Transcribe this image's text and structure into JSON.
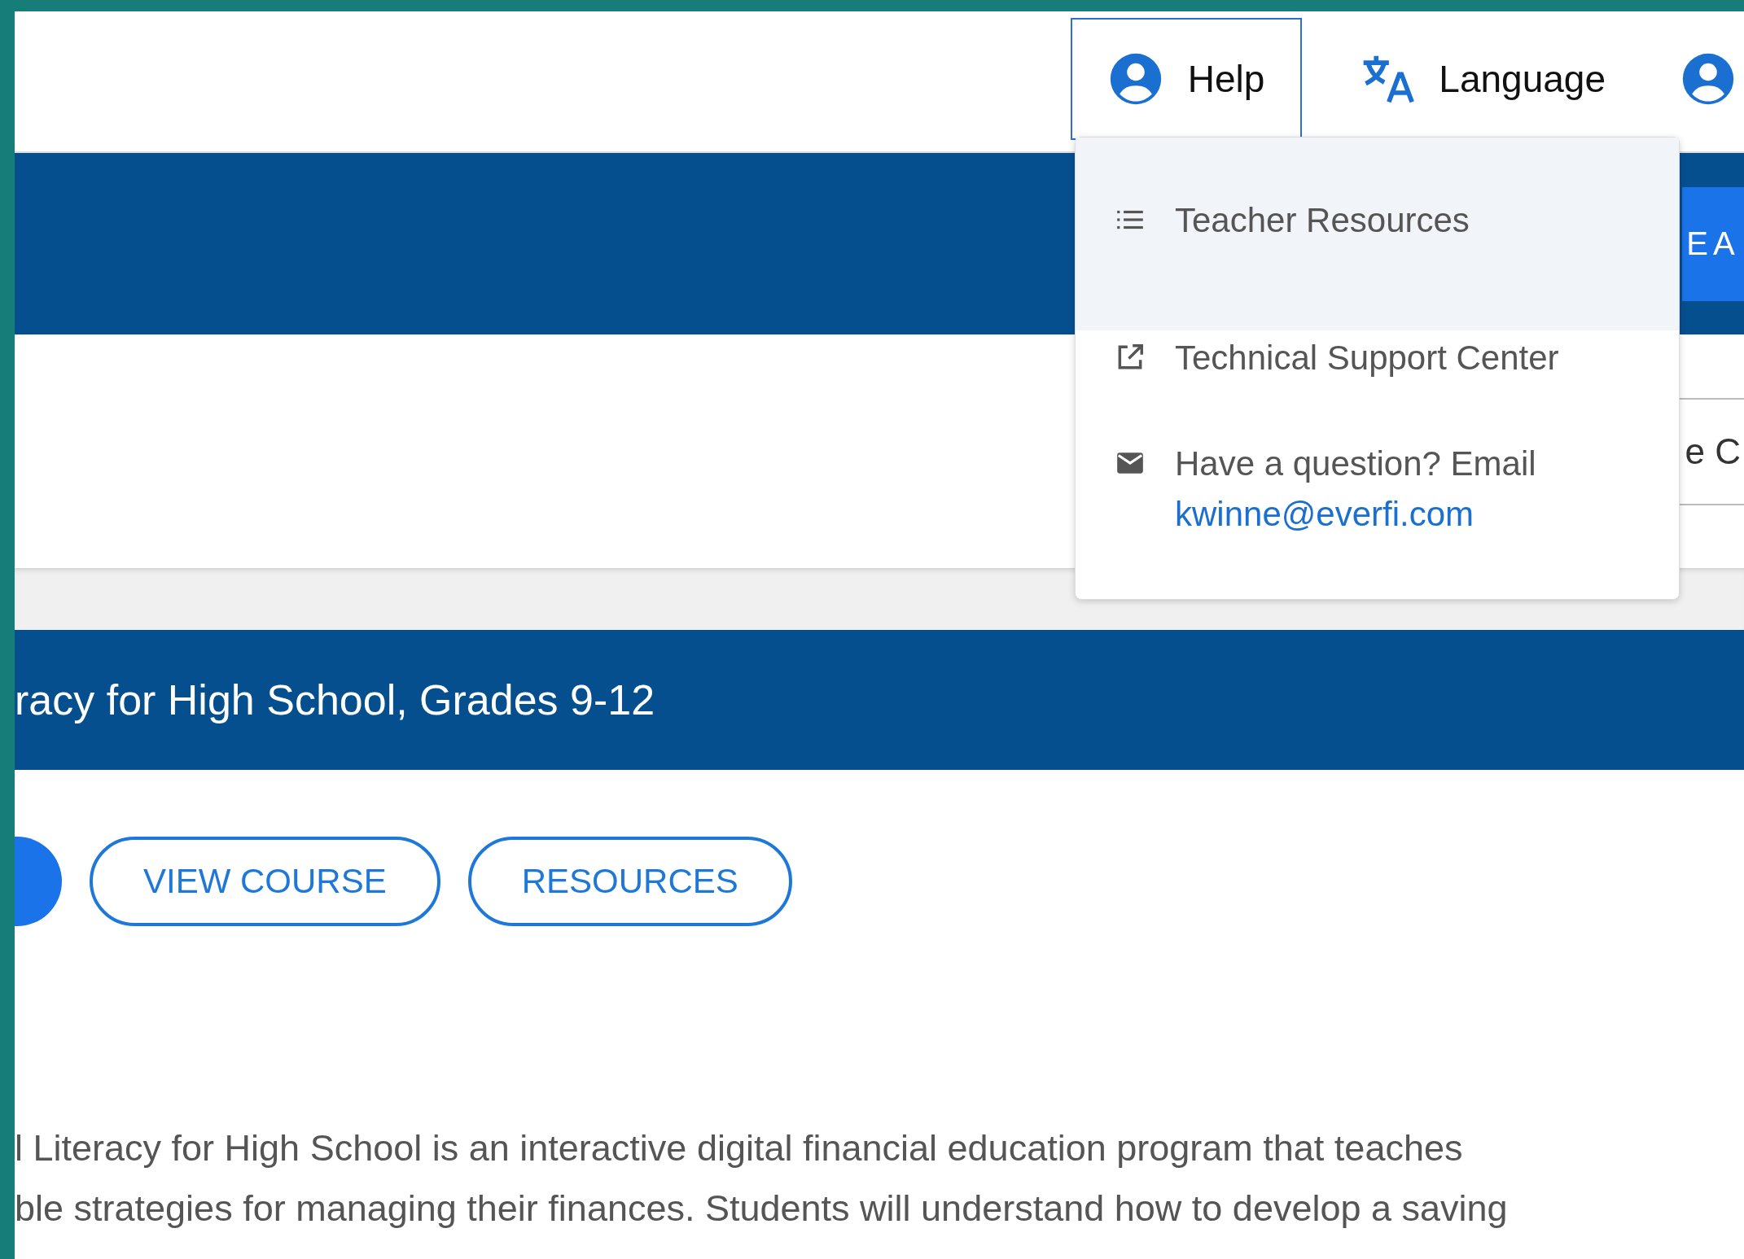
{
  "header": {
    "nav": [
      {
        "kind": "help",
        "label": "Help",
        "selected": true
      },
      {
        "kind": "language",
        "label": "Language",
        "selected": false
      },
      {
        "kind": "account",
        "selected": false
      }
    ]
  },
  "help_menu": {
    "items": [
      {
        "kind": "list",
        "label": "Teacher Resources",
        "highlighted": true
      },
      {
        "kind": "external",
        "label": "Technical Support Center",
        "highlighted": false
      },
      {
        "kind": "email",
        "label": "Have a question? Email",
        "link": "kwinne@everfi.com",
        "highlighted": false
      }
    ]
  },
  "banner": {
    "button_text": "EA"
  },
  "filter": {
    "value": "e C"
  },
  "course": {
    "title": "racy for High School, Grades 9-12",
    "buttons": [
      {
        "kind": "round"
      },
      {
        "kind": "outline",
        "label": "VIEW COURSE"
      },
      {
        "kind": "outline",
        "label": "RESOURCES"
      }
    ],
    "description_lines": [
      "l Literacy for High School is an interactive digital financial education program that teaches",
      "ble strategies for managing their finances. Students will understand how to develop a saving"
    ]
  }
}
